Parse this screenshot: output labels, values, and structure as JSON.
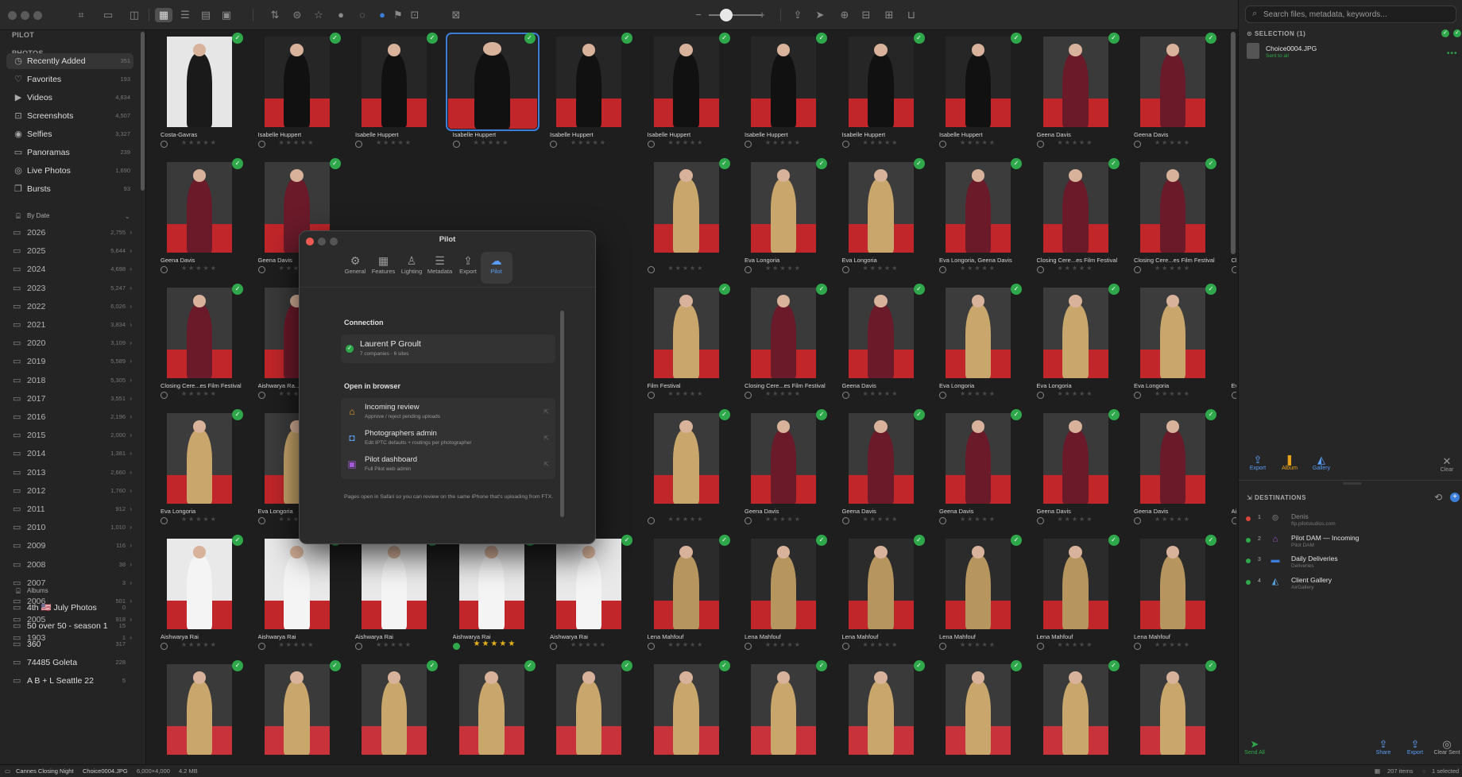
{
  "window": {
    "traffic": [
      "close",
      "minimize",
      "zoom"
    ]
  },
  "toolbar": {
    "left_icons": [
      "camera-icon",
      "folder-import-icon",
      "sidebar-toggle-icon",
      "grid-view-icon",
      "list-view-icon",
      "detail-view-icon",
      "photo-view-icon"
    ],
    "filter_icons": [
      "sort-icon",
      "filter-icon",
      "star-filter-icon",
      "color-label-icon",
      "check-circle-icon",
      "blue-tag-icon",
      "flag-icon",
      "pilot-badge-icon",
      "person-icon"
    ],
    "zoom_minus": "−",
    "zoom_plus": "+",
    "right_icons": [
      "share-icon",
      "send-icon",
      "zoom-in-icon",
      "export-icon",
      "import-icon",
      "deliver-icon"
    ]
  },
  "sidebar": {
    "app_header": "PILOT",
    "photos_header": "PHOTOS",
    "photos": [
      {
        "label": "Recently Added",
        "count": "351",
        "icon": "clock-icon"
      },
      {
        "label": "Favorites",
        "count": "193",
        "icon": "heart-icon"
      },
      {
        "label": "Videos",
        "count": "4,834",
        "icon": "video-icon"
      },
      {
        "label": "Screenshots",
        "count": "4,507",
        "icon": "screenshot-icon"
      },
      {
        "label": "Selfies",
        "count": "3,327",
        "icon": "selfie-icon"
      },
      {
        "label": "Panoramas",
        "count": "239",
        "icon": "panorama-icon"
      },
      {
        "label": "Live Photos",
        "count": "1,690",
        "icon": "live-photo-icon"
      },
      {
        "label": "Bursts",
        "count": "93",
        "icon": "burst-icon"
      }
    ],
    "by_date_header": "By Date",
    "years": [
      {
        "label": "2026",
        "count": "2,755"
      },
      {
        "label": "2025",
        "count": "5,644"
      },
      {
        "label": "2024",
        "count": "4,698"
      },
      {
        "label": "2023",
        "count": "5,247"
      },
      {
        "label": "2022",
        "count": "6,026"
      },
      {
        "label": "2021",
        "count": "3,834"
      },
      {
        "label": "2020",
        "count": "3,109"
      },
      {
        "label": "2019",
        "count": "5,589"
      },
      {
        "label": "2018",
        "count": "5,305"
      },
      {
        "label": "2017",
        "count": "3,551"
      },
      {
        "label": "2016",
        "count": "2,196"
      },
      {
        "label": "2015",
        "count": "2,000"
      },
      {
        "label": "2014",
        "count": "1,381"
      },
      {
        "label": "2013",
        "count": "2,660"
      },
      {
        "label": "2012",
        "count": "1,760"
      },
      {
        "label": "2011",
        "count": "912"
      },
      {
        "label": "2010",
        "count": "1,010"
      },
      {
        "label": "2009",
        "count": "116"
      },
      {
        "label": "2008",
        "count": "38"
      },
      {
        "label": "2007",
        "count": "3"
      },
      {
        "label": "2006",
        "count": "501"
      },
      {
        "label": "2005",
        "count": "918"
      },
      {
        "label": "1903",
        "count": "1"
      }
    ],
    "albums_header": "Albums",
    "albums": [
      {
        "label": "4th 🇺🇸 July Photos",
        "count": "0"
      },
      {
        "label": "50 over 50 - season 1",
        "count": "15"
      },
      {
        "label": "360",
        "count": "317"
      },
      {
        "label": "74485 Goleta",
        "count": "228"
      },
      {
        "label": "A B + L Seattle 22",
        "count": "5"
      }
    ]
  },
  "grid": {
    "rows": [
      [
        "Costa-Gavras",
        "Isabelle Huppert",
        "Isabelle Huppert",
        "Isabelle Huppert",
        "Isabelle Huppert",
        "Isabelle Huppert",
        "Isabelle Huppert",
        "Isabelle Huppert",
        "Isabelle Huppert",
        "Geena Davis",
        "Geena Davis"
      ],
      [
        "Geena Davis",
        "Geena Davis",
        "",
        "",
        "",
        "",
        "Eva Longoria",
        "Eva Longoria",
        "Eva Longoria, Geena Davis",
        "Closing Cere...es Film Festival",
        "Closing Cere...es Film Festival",
        "Closing Cere...es Film Festival"
      ],
      [
        "Closing Cere...es Film Festival",
        "Aishwarya Ra...",
        "",
        "",
        "",
        "Film Festival",
        "Closing Cere...es Film Festival",
        "Geena Davis",
        "Eva Longoria",
        "Eva Longoria",
        "Eva Longoria",
        "Eva Longoria"
      ],
      [
        "Eva Longoria",
        "Eva Longoria",
        "",
        "",
        "",
        "",
        "Geena Davis",
        "Geena Davis",
        "Geena Davis",
        "Geena Davis",
        "Geena Davis",
        "Aishwarya Rai"
      ],
      [
        "Aishwarya Rai",
        "Aishwarya Rai",
        "Aishwarya Rai",
        "Aishwarya Rai",
        "Aishwarya Rai",
        "Lena Mahfouf",
        "Lena Mahfouf",
        "Lena Mahfouf",
        "Lena Mahfouf",
        "Lena Mahfouf",
        "Lena Mahfouf"
      ],
      [
        "",
        "",
        "",
        "",
        "",
        "",
        "",
        "",
        "",
        "",
        "",
        ""
      ]
    ],
    "stars_empty": "★★★★★",
    "selected_stars": "★★★★★"
  },
  "dialog": {
    "title": "Pilot",
    "tabs": [
      {
        "label": "General",
        "icon": "gear-icon"
      },
      {
        "label": "Features",
        "icon": "features-icon"
      },
      {
        "label": "Lighting",
        "icon": "lightbulb-icon"
      },
      {
        "label": "Metadata",
        "icon": "metadata-icon"
      },
      {
        "label": "Export",
        "icon": "export-icon"
      },
      {
        "label": "Pilot",
        "icon": "cloud-icon"
      }
    ],
    "connection_header": "Connection",
    "connection_name": "Laurent P Groult",
    "connection_sub": "7 companies · 6 sites",
    "open_header": "Open in browser",
    "links": [
      {
        "title": "Incoming review",
        "sub": "Approve / reject pending uploads",
        "icon": "inbox-icon"
      },
      {
        "title": "Photographers admin",
        "sub": "Edit IPTC defaults + routings per photographer",
        "icon": "person-badge-icon"
      },
      {
        "title": "Pilot dashboard",
        "sub": "Full Pilot web admin",
        "icon": "dashboard-icon"
      }
    ],
    "footnote": "Pages open in Safari so you can review on the same iPhone that's uploading from FTX."
  },
  "right_panel": {
    "search_placeholder": "Search files, metadata, keywords...",
    "selection_header": "SELECTION",
    "selection_count": "(1)",
    "selected_file": "Choice0004.JPG",
    "selected_status": "Sent to all",
    "actions": [
      {
        "label": "Export",
        "icon": "export-icon"
      },
      {
        "label": "Album",
        "icon": "bookmark-icon"
      },
      {
        "label": "Gallery",
        "icon": "gallery-icon"
      }
    ],
    "clear_label": "Clear",
    "destinations_header": "DESTINATIONS",
    "destinations": [
      {
        "num": "1",
        "name": "Denis",
        "sub": "ftp.pilotstudios.com",
        "dot": "#d9443b",
        "icon": "server-icon"
      },
      {
        "num": "2",
        "name": "Pilot DAM — Incoming",
        "sub": "Pilot DAM",
        "dot": "#2ea84a",
        "icon": "inbox-icon"
      },
      {
        "num": "3",
        "name": "Daily Deliveries",
        "sub": "Deliveries",
        "dot": "#2ea84a",
        "icon": "folder-icon"
      },
      {
        "num": "4",
        "name": "Client Gallery",
        "sub": "AirGallery",
        "dot": "#2ea84a",
        "icon": "gallery-icon"
      }
    ],
    "send_all": "Send All",
    "bottom_actions": [
      "Share",
      "Export",
      "Clear Sent"
    ]
  },
  "status_bar": {
    "album": "Cannes Closing Night",
    "file": "Choice0004.JPG",
    "dims": "6,000×4,000",
    "size": "4.2 MB",
    "items": "207 items",
    "selected": "1 selected"
  },
  "colors": {
    "accent": "#3c7dd9",
    "sent": "#2ea84a",
    "carpet": "#c0262a",
    "star": "#e8b21c"
  }
}
